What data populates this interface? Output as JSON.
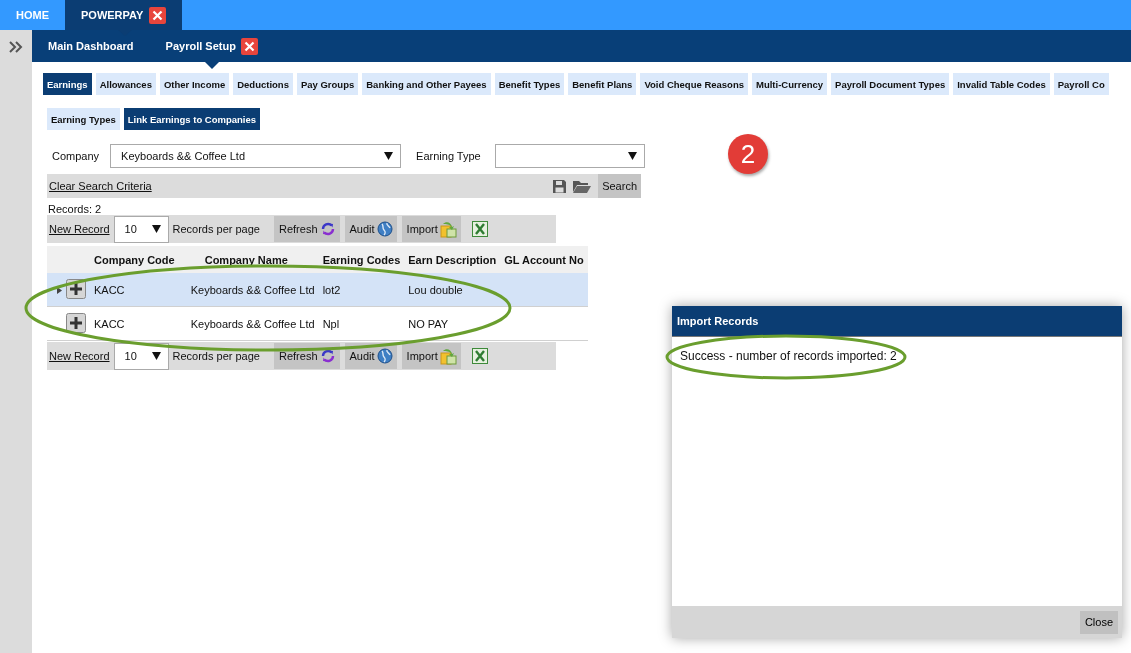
{
  "top_tabs": [
    {
      "label": "HOME",
      "selected": false,
      "closable": false
    },
    {
      "label": "POWERPAY",
      "selected": true,
      "closable": true
    }
  ],
  "sub_nav": [
    {
      "label": "Main Dashboard",
      "selected": false,
      "closable": false
    },
    {
      "label": "Payroll Setup",
      "selected": true,
      "closable": true
    }
  ],
  "section_tabs": [
    {
      "label": "Earnings",
      "selected": true
    },
    {
      "label": "Allowances",
      "selected": false
    },
    {
      "label": "Other Income",
      "selected": false
    },
    {
      "label": "Deductions",
      "selected": false
    },
    {
      "label": "Pay Groups",
      "selected": false
    },
    {
      "label": "Banking and Other Payees",
      "selected": false
    },
    {
      "label": "Benefit Types",
      "selected": false
    },
    {
      "label": "Benefit Plans",
      "selected": false
    },
    {
      "label": "Void Cheque Reasons",
      "selected": false
    },
    {
      "label": "Multi-Currency",
      "selected": false
    },
    {
      "label": "Payroll Document Types",
      "selected": false
    },
    {
      "label": "Invalid Table Codes",
      "selected": false
    },
    {
      "label": "Payroll Co",
      "selected": false
    }
  ],
  "sub_tabs": [
    {
      "label": "Earning Types",
      "selected": false
    },
    {
      "label": "Link Earnings to Companies",
      "selected": true
    }
  ],
  "filters": {
    "company": {
      "label": "Company",
      "value": "Keyboards && Coffee Ltd"
    },
    "earning_type": {
      "label": "Earning Type"
    }
  },
  "search_bar": {
    "link": "Clear Search Criteria",
    "button": "Search"
  },
  "records_count": "Records:  2",
  "toolbars": [
    {
      "new_record": "New Record",
      "page_size": "10",
      "per_page_label": "Records per page",
      "buttons": [
        {
          "label": "Refresh",
          "kind": "refresh"
        },
        {
          "label": "Audit",
          "kind": "audit"
        },
        {
          "label": "Import",
          "kind": "import"
        }
      ]
    },
    {
      "new_record": "New Record",
      "page_size": "10",
      "per_page_label": "Records per page",
      "buttons": [
        {
          "label": "Refresh",
          "kind": "refresh"
        },
        {
          "label": "Audit",
          "kind": "audit"
        },
        {
          "label": "Import",
          "kind": "import"
        }
      ]
    }
  ],
  "table": {
    "columns": [
      "Company Code",
      "Company Name",
      "Earning Codes",
      "Earn Description",
      "GL Account No"
    ],
    "rows": [
      {
        "selected": true,
        "cells": [
          "KACC",
          "Keyboards && Coffee Ltd",
          "lot2",
          "Lou double"
        ]
      },
      {
        "selected": false,
        "cells": [
          "KACC",
          "Keyboards && Coffee Ltd",
          "Npl",
          "NO PAY"
        ]
      }
    ]
  },
  "step_badge": "2",
  "dialog": {
    "title": "Import Records",
    "message": "Success - number of records imported: 2",
    "close_button": "Close"
  }
}
